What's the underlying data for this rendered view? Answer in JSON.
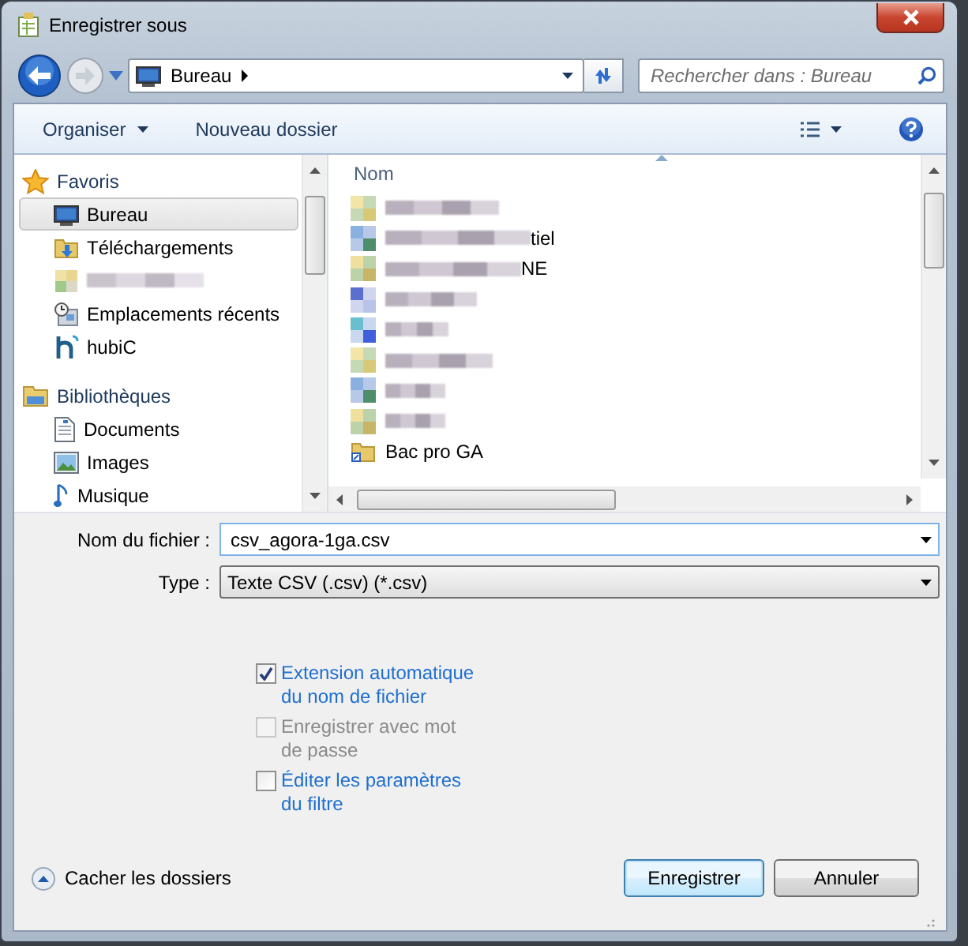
{
  "window": {
    "title": "Enregistrer sous"
  },
  "address": {
    "path": "Bureau"
  },
  "search": {
    "placeholder": "Rechercher dans : Bureau"
  },
  "toolbar": {
    "organize": "Organiser",
    "new_folder": "Nouveau dossier"
  },
  "sidebar": {
    "groups": [
      {
        "label": "Favoris",
        "kind": "favorites",
        "items": [
          {
            "kind": "desktop",
            "label": "Bureau",
            "selected": true
          },
          {
            "kind": "downloads",
            "label": "Téléchargements",
            "selected": false
          },
          {
            "kind": "redacted",
            "selected": false
          },
          {
            "kind": "recent",
            "label": "Emplacements récents",
            "selected": false
          },
          {
            "kind": "hubic",
            "label": "hubiC",
            "selected": false
          }
        ]
      },
      {
        "label": "Bibliothèques",
        "kind": "libraries",
        "items": [
          {
            "kind": "documents",
            "label": "Documents",
            "selected": false
          },
          {
            "kind": "images",
            "label": "Images",
            "selected": false
          },
          {
            "kind": "music",
            "label": "Musique",
            "selected": false
          }
        ]
      }
    ]
  },
  "file_list": {
    "column": "Nom",
    "files": [
      {
        "kind": "redacted"
      },
      {
        "kind": "partial",
        "text": "tiel"
      },
      {
        "kind": "partial",
        "text": "NE"
      },
      {
        "kind": "redacted"
      },
      {
        "kind": "redacted"
      },
      {
        "kind": "redacted"
      },
      {
        "kind": "redacted"
      },
      {
        "kind": "redacted"
      },
      {
        "kind": "folder",
        "text": "Bac pro GA"
      }
    ]
  },
  "form": {
    "filename_label": "Nom du fichier :",
    "filename": "csv_agora-1ga.csv",
    "type_label": "Type :",
    "type": "Texte CSV (.csv) (*.csv)"
  },
  "options": [
    {
      "label": "Extension automatique du nom de fichier",
      "checked": true,
      "disabled": false
    },
    {
      "label": "Enregistrer avec mot de passe",
      "checked": false,
      "disabled": true
    },
    {
      "label": "Éditer les paramètres du filtre",
      "checked": false,
      "disabled": false
    }
  ],
  "hide_folders": "Cacher les dossiers",
  "buttons": [
    {
      "label": "Enregistrer",
      "default": true
    },
    {
      "label": "Annuler",
      "default": false
    }
  ]
}
